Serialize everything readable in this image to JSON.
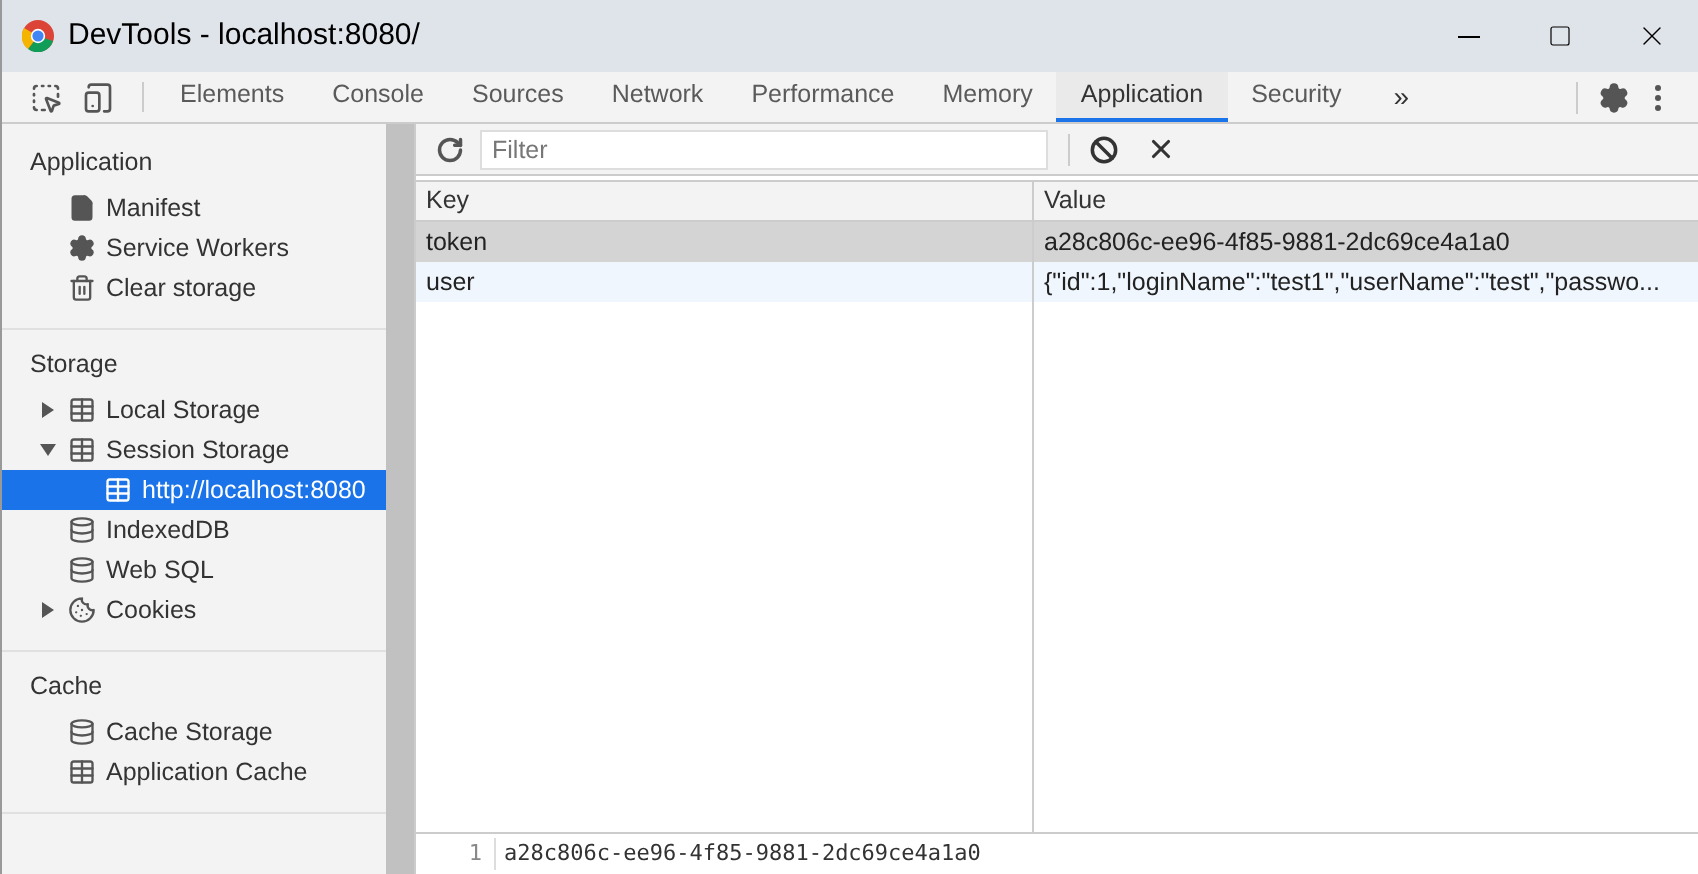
{
  "window": {
    "title": "DevTools - localhost:8080/"
  },
  "tabs": [
    {
      "label": "Elements",
      "selected": false
    },
    {
      "label": "Console",
      "selected": false
    },
    {
      "label": "Sources",
      "selected": false
    },
    {
      "label": "Network",
      "selected": false
    },
    {
      "label": "Performance",
      "selected": false
    },
    {
      "label": "Memory",
      "selected": false
    },
    {
      "label": "Application",
      "selected": true
    },
    {
      "label": "Security",
      "selected": false
    }
  ],
  "more_tabs": "»",
  "sidebar": {
    "sections": [
      {
        "title": "Application",
        "items": [
          {
            "label": "Manifest",
            "kind": "file",
            "selected": false
          },
          {
            "label": "Service Workers",
            "kind": "gear",
            "selected": false
          },
          {
            "label": "Clear storage",
            "kind": "trash",
            "selected": false
          }
        ]
      },
      {
        "title": "Storage",
        "items": [
          {
            "label": "Local Storage",
            "kind": "grid",
            "expanded": false,
            "selected": false
          },
          {
            "label": "Session Storage",
            "kind": "grid",
            "expanded": true,
            "selected": false,
            "children": [
              {
                "label": "http://localhost:8080",
                "kind": "grid",
                "selected": true
              }
            ]
          },
          {
            "label": "IndexedDB",
            "kind": "db",
            "selected": false
          },
          {
            "label": "Web SQL",
            "kind": "db",
            "selected": false
          },
          {
            "label": "Cookies",
            "kind": "cookie",
            "expanded": false,
            "selected": false
          }
        ]
      },
      {
        "title": "Cache",
        "items": [
          {
            "label": "Cache Storage",
            "kind": "db",
            "selected": false
          },
          {
            "label": "Application Cache",
            "kind": "grid",
            "selected": false
          }
        ]
      }
    ]
  },
  "filter": {
    "placeholder": "Filter"
  },
  "table": {
    "columns": [
      "Key",
      "Value"
    ],
    "rows": [
      {
        "key": "token",
        "value": "a28c806c-ee96-4f85-9881-2dc69ce4a1a0",
        "selected": true
      },
      {
        "key": "user",
        "value": "{\"id\":1,\"loginName\":\"test1\",\"userName\":\"test\",\"passwo...",
        "selected": false
      }
    ]
  },
  "preview": {
    "line_number": "1",
    "text": "a28c806c-ee96-4f85-9881-2dc69ce4a1a0"
  }
}
